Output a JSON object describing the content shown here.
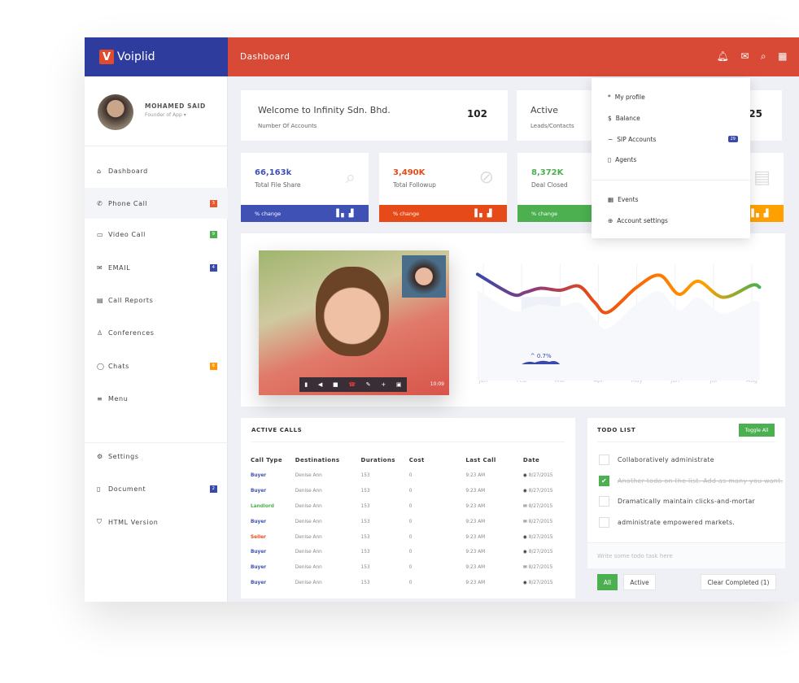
{
  "brand": {
    "logo_letter": "V",
    "name": "Voiplid"
  },
  "header": {
    "title": "Dashboard",
    "icons": [
      "bell-icon",
      "mail-icon",
      "search-icon",
      "grid-icon"
    ]
  },
  "user": {
    "name": "MOHAMED SAID",
    "role": "Founder of App ▾"
  },
  "sidebar": {
    "items": [
      {
        "label": "Dashboard",
        "icon": "home-icon",
        "glyph": "⌂"
      },
      {
        "label": "Phone Call",
        "icon": "phone-icon",
        "glyph": "✆",
        "badge": "3",
        "badge_color": "#e8572c"
      },
      {
        "label": "Video Call",
        "icon": "video-icon",
        "glyph": "▭",
        "badge": "9",
        "badge_color": "#4caf50"
      },
      {
        "label": "EMAIL",
        "icon": "envelope-icon",
        "glyph": "✉",
        "badge": "4",
        "badge_color": "#3949ab"
      },
      {
        "label": "Call Reports",
        "icon": "report-icon",
        "glyph": "▤"
      },
      {
        "label": "Conferences",
        "icon": "conference-icon",
        "glyph": "♙"
      },
      {
        "label": "Chats",
        "icon": "chat-icon",
        "glyph": "◯",
        "badge": "8",
        "badge_color": "#ff9800"
      },
      {
        "label": "Menu",
        "icon": "menu-icon",
        "glyph": "≡"
      },
      {
        "label": "Settings",
        "icon": "gear-icon",
        "glyph": "⚙"
      },
      {
        "label": "Document",
        "icon": "document-icon",
        "glyph": "▯",
        "badge": "2",
        "badge_color": "#3949ab"
      },
      {
        "label": "HTML Version",
        "icon": "shield-icon",
        "glyph": "⛉"
      }
    ]
  },
  "welcome": {
    "title": "Welcome to Infinity Sdn. Bhd.",
    "subtitle": "Number Of  Accounts",
    "value": "102"
  },
  "active": {
    "title": "Active",
    "subtitle": "Leads/Contacts",
    "value": "25"
  },
  "stats": [
    {
      "value": "66,163k",
      "label": "Total File Share",
      "color": "#3f51b5",
      "icon": "paperclip-icon",
      "glyph": "⌕",
      "bar": "% change"
    },
    {
      "value": "3,490K",
      "label": "Total Followup",
      "color": "#e64a19",
      "icon": "ban-icon",
      "glyph": "⊘",
      "bar": "% change"
    },
    {
      "value": "8,372K",
      "label": "Deal Closed",
      "color": "#4caf50",
      "icon": "check-icon",
      "glyph": "",
      "bar": "% change"
    },
    {
      "value": "",
      "label": "",
      "color": "#ffa000",
      "icon": "clipboard-icon",
      "glyph": "▤",
      "bar": ""
    }
  ],
  "profile_menu": {
    "items": [
      {
        "label": "My profile",
        "glyph": "*"
      },
      {
        "label": "Balance",
        "glyph": "$"
      },
      {
        "label": "SIP Accounts",
        "glyph": "~",
        "badge": "29"
      },
      {
        "label": "Agents",
        "glyph": "▯"
      },
      {
        "label": "Events",
        "glyph": "▦"
      },
      {
        "label": "Account settings",
        "glyph": "⊕"
      }
    ]
  },
  "video": {
    "timer": "10:09",
    "controls": [
      "microphone-icon",
      "speaker-icon",
      "camera-icon",
      "hangup-icon",
      "pen-icon",
      "add-user-icon",
      "hd-icon"
    ]
  },
  "chart_data": {
    "type": "line",
    "categories": [
      "Jan",
      "Feb",
      "Mar",
      "Apr",
      "May",
      "Jun",
      "Jul",
      "Aug"
    ],
    "points": [
      [
        0.85,
        90
      ],
      [
        1.75,
        70
      ],
      [
        2.1,
        72
      ],
      [
        2.5,
        76
      ],
      [
        3,
        74
      ],
      [
        3.5,
        78
      ],
      [
        3.9,
        62
      ],
      [
        4.25,
        52
      ],
      [
        5.0,
        77
      ],
      [
        5.6,
        89
      ],
      [
        6.1,
        70
      ],
      [
        6.6,
        83
      ],
      [
        7.25,
        67
      ],
      [
        8,
        79
      ],
      [
        8.2,
        77
      ]
    ],
    "ylim": [
      0,
      100
    ],
    "highlight": {
      "from": "Feb",
      "to": "Mar",
      "label": "^ 0.7%"
    },
    "gradient": [
      "#3949ab",
      "#8e3a7a",
      "#e64a19",
      "#ff6d00",
      "#ffa000",
      "#4caf50"
    ],
    "grid": true
  },
  "calls": {
    "title": "ACTIVE CALLS",
    "columns": [
      "Call Type",
      "Destinations",
      "Durations",
      "Cost",
      "Last Call",
      "Date"
    ],
    "rows": [
      {
        "type": "Buyer",
        "color": "#3f51b5",
        "dest": "Denise Ann",
        "dur": "153",
        "cost": "0",
        "last": "9:23 AM",
        "date": "8/27/2015",
        "icon": "◉"
      },
      {
        "type": "Buyer",
        "color": "#3f51b5",
        "dest": "Denise Ann",
        "dur": "153",
        "cost": "0",
        "last": "9:23 AM",
        "date": "8/27/2015",
        "icon": "◉"
      },
      {
        "type": "Landlord",
        "color": "#4caf50",
        "dest": "Denise Ann",
        "dur": "153",
        "cost": "0",
        "last": "9:23 AM",
        "date": "8/27/2015",
        "icon": "✉"
      },
      {
        "type": "Buyer",
        "color": "#3f51b5",
        "dest": "Denise Ann",
        "dur": "153",
        "cost": "0",
        "last": "9:23 AM",
        "date": "8/27/2015",
        "icon": "✉"
      },
      {
        "type": "Seller",
        "color": "#e64a19",
        "dest": "Denise Ann",
        "dur": "153",
        "cost": "0",
        "last": "9:23 AM",
        "date": "8/27/2015",
        "icon": "◉"
      },
      {
        "type": "Buyer",
        "color": "#3f51b5",
        "dest": "Denise Ann",
        "dur": "153",
        "cost": "0",
        "last": "9:23 AM",
        "date": "8/27/2015",
        "icon": "◉"
      },
      {
        "type": "Buyer",
        "color": "#3f51b5",
        "dest": "Denise Ann",
        "dur": "153",
        "cost": "0",
        "last": "9:23 AM",
        "date": "8/27/2015",
        "icon": "✉"
      },
      {
        "type": "Buyer",
        "color": "#3f51b5",
        "dest": "Denise Ann",
        "dur": "153",
        "cost": "0",
        "last": "9:23 AM",
        "date": "8/27/2015",
        "icon": "◉"
      }
    ]
  },
  "todo": {
    "title": "TODO LIST",
    "toggle_all": "Toggle All",
    "items": [
      {
        "text": "Collaboratively administrate",
        "done": false
      },
      {
        "text": "Another todo on the list. Add as many you want.",
        "done": true
      },
      {
        "text": "Dramatically maintain clicks-and-mortar",
        "done": false
      },
      {
        "text": "administrate empowered markets.",
        "done": false
      }
    ],
    "placeholder": "Write some todo task here",
    "filters": {
      "all": "All",
      "active": "Active",
      "clear": "Clear Completed (1)"
    }
  }
}
